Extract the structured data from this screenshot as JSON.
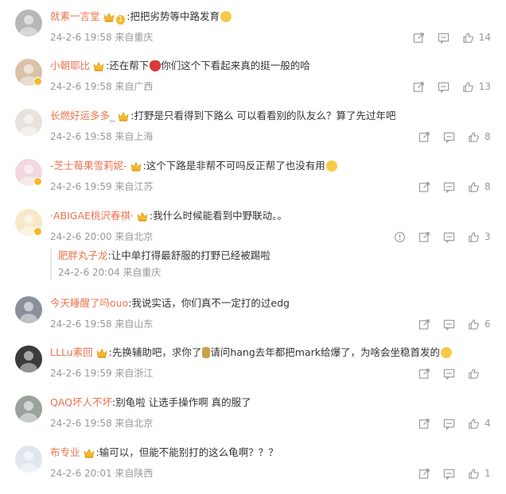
{
  "comments": [
    {
      "user": "就素一言堂",
      "badge_level": "1",
      "has_crown": true,
      "text_before_emoji": ":把把劣势等中路发育",
      "emoji": "laugh",
      "text_after_emoji": "",
      "meta": "24-2-6 19:58 来自重庆",
      "likes": "14",
      "avatar_color": "#b7b7b7"
    },
    {
      "user": "小朝耶比",
      "has_crown": true,
      "text_before_emoji": ":还在帮下",
      "emoji": "rose",
      "text_after_emoji": "你们这个下看起来真的挺一般的哈",
      "meta": "24-2-6 19:58 来自广西",
      "likes": "13",
      "avatar_color": "#d9c2a8"
    },
    {
      "user": "长燃好运多多_",
      "has_crown": true,
      "text_before_emoji": ":打野是只看得到下路么 可以看看别的队友么？算了先过年吧",
      "emoji": "",
      "text_after_emoji": "",
      "meta": "24-2-6 19:58 来自上海",
      "likes": "8",
      "avatar_color": "#e8e2dc"
    },
    {
      "user": "-芝士莓果雪莉妮-",
      "has_crown": true,
      "text_before_emoji": ":这个下路是非帮不可吗反正帮了也没有用",
      "emoji": "sweat",
      "text_after_emoji": "",
      "meta": "24-2-6 19:59 来自江苏",
      "likes": "8",
      "avatar_color": "#f2d7dc"
    },
    {
      "user": "·ABIGAE桃沢春祺·",
      "has_crown": true,
      "text_before_emoji": ":我什么时候能看到中野联动。。",
      "emoji": "",
      "text_after_emoji": "",
      "meta": "24-2-6 20:00 来自北京",
      "likes": "3",
      "has_report": true,
      "avatar_color": "#f7e9c8",
      "reply": {
        "user": "肥胖丸子龙",
        "text": ":让中单打得最舒服的打野已经被踢啦",
        "meta": "24-2-6 20:04 来自重庆"
      }
    },
    {
      "user": "今天睡醒了吗ouo",
      "has_crown": false,
      "text_before_emoji": ":我说实话，你们真不一定打的过edg",
      "emoji": "",
      "text_after_emoji": "",
      "meta": "24-2-6 19:58 来自山东",
      "likes": "6",
      "avatar_color": "#8a8f9a"
    },
    {
      "user": "LLLu素回",
      "has_crown": true,
      "text_before_emoji": ":先换辅助吧，求你了",
      "emoji": "bottle",
      "text_after_emoji": "请问hang去年都把mark给爆了，为啥会坐稳首发的",
      "emoji2": "sweat",
      "meta": "24-2-6 19:59 来自浙江",
      "likes": "",
      "avatar_color": "#3b3b3b"
    },
    {
      "user": "QAQ坏人不坏",
      "has_crown": false,
      "text_before_emoji": ":别龟啦   让选手操作啊   真的服了",
      "emoji": "",
      "text_after_emoji": "",
      "meta": "24-2-6 19:58 来自北京",
      "likes": "4",
      "avatar_color": "#9aa39b"
    },
    {
      "user": "布专业",
      "has_crown": true,
      "text_before_emoji": ":输可以，但能不能别打的这么龟啊？？？",
      "emoji": "",
      "text_after_emoji": "",
      "meta": "24-2-6 20:01 来自陕西",
      "likes": "1",
      "avatar_color": "#e1e6ee"
    }
  ],
  "colors": {
    "username": "#eb7350",
    "meta": "#999999",
    "crown": "#f5b82e"
  }
}
